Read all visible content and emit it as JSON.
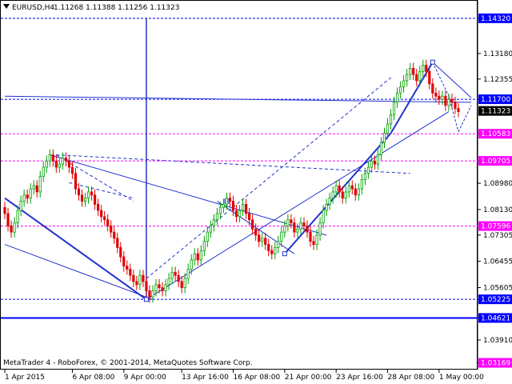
{
  "header": {
    "symbol_timeframe": "EURUSD,H4",
    "ohlc": "1.11268 1.11388 1.11256 1.11323"
  },
  "footer": {
    "copyright": "MetaTrader 4 - RoboForex, © 2001-2014, MetaQuotes Software Corp."
  },
  "colors": {
    "up": "#00a000",
    "down": "#e00000",
    "level_label_blue": "#0000ff",
    "level_label_magenta": "#ff00ff",
    "current_price_bg": "#000000",
    "trend": "#2233cc",
    "magenta_level": "#ff33ff"
  },
  "chart_data": {
    "type": "candlestick",
    "symbol": "EURUSD",
    "timeframe": "H4",
    "ylim": [
      1.0295,
      1.1455
    ],
    "y_ticks": [
      1.1432,
      1.1318,
      1.12355,
      1.117,
      1.10583,
      1.09705,
      1.0898,
      1.0813,
      1.07305,
      1.06455,
      1.05605,
      1.05225,
      1.04621,
      1.0391,
      1.03169
    ],
    "y_tick_labels": [
      "1.14320",
      "1.13180",
      "1.12355",
      "1.11700",
      "1.10583",
      "1.09705",
      "1.08980",
      "1.08130",
      "1.07305",
      "1.06455",
      "1.05605",
      "1.05225",
      "1.04621",
      "1.03910",
      "1.03169"
    ],
    "x_labels": [
      {
        "label": "1 Apr 2015",
        "index": 0
      },
      {
        "label": "6 Apr 08:00",
        "index": 21
      },
      {
        "label": "9 Apr 00:00",
        "index": 37
      },
      {
        "label": "13 Apr 16:00",
        "index": 55
      },
      {
        "label": "16 Apr 08:00",
        "index": 71
      },
      {
        "label": "21 Apr 00:00",
        "index": 87
      },
      {
        "label": "23 Apr 16:00",
        "index": 103
      },
      {
        "label": "28 Apr 08:00",
        "index": 119
      },
      {
        "label": "1 May 00:00",
        "index": 135
      }
    ],
    "levels": [
      {
        "value": 1.1432,
        "label": "1.14320",
        "color": "#0000ff",
        "style": "dashed"
      },
      {
        "value": 1.117,
        "label": "1.11700",
        "color": "#0000ff",
        "style": "dashed"
      },
      {
        "value": 1.11323,
        "label": "1.11323",
        "color": "#000000",
        "style": "none"
      },
      {
        "value": 1.10583,
        "label": "1.10583",
        "color": "#ff00ff",
        "style": "dashed"
      },
      {
        "value": 1.09705,
        "label": "1.09705",
        "color": "#ff00ff",
        "style": "dashed"
      },
      {
        "value": 1.07596,
        "label": "1.07596",
        "color": "#ff00ff",
        "style": "dashed"
      },
      {
        "value": 1.05225,
        "label": "1.05225",
        "color": "#0000ff",
        "style": "dashed"
      },
      {
        "value": 1.04621,
        "label": "1.04621",
        "color": "#0000ff",
        "style": "solid"
      },
      {
        "value": 1.03169,
        "label": "1.03169",
        "color": "#ff00ff",
        "style": "none"
      }
    ],
    "candles_close": [
      1.08,
      1.076,
      1.074,
      1.077,
      1.081,
      1.084,
      1.086,
      1.085,
      1.088,
      1.089,
      1.087,
      1.092,
      1.095,
      1.097,
      1.099,
      1.097,
      1.095,
      1.096,
      1.098,
      1.097,
      1.095,
      1.093,
      1.088,
      1.086,
      1.084,
      1.085,
      1.087,
      1.086,
      1.083,
      1.081,
      1.079,
      1.078,
      1.076,
      1.074,
      1.072,
      1.069,
      1.066,
      1.063,
      1.062,
      1.06,
      1.058,
      1.057,
      1.06,
      1.058,
      1.055,
      1.053,
      1.055,
      1.057,
      1.056,
      1.055,
      1.057,
      1.059,
      1.061,
      1.06,
      1.058,
      1.056,
      1.059,
      1.062,
      1.065,
      1.067,
      1.065,
      1.068,
      1.071,
      1.074,
      1.076,
      1.078,
      1.08,
      1.082,
      1.083,
      1.085,
      1.084,
      1.081,
      1.079,
      1.081,
      1.083,
      1.08,
      1.078,
      1.075,
      1.073,
      1.071,
      1.072,
      1.07,
      1.068,
      1.067,
      1.069,
      1.071,
      1.074,
      1.076,
      1.078,
      1.077,
      1.074,
      1.075,
      1.077,
      1.076,
      1.074,
      1.071,
      1.07,
      1.073,
      1.077,
      1.081,
      1.083,
      1.085,
      1.087,
      1.089,
      1.087,
      1.085,
      1.087,
      1.089,
      1.088,
      1.086,
      1.088,
      1.091,
      1.093,
      1.095,
      1.097,
      1.096,
      1.099,
      1.103,
      1.106,
      1.109,
      1.112,
      1.116,
      1.119,
      1.121,
      1.123,
      1.125,
      1.127,
      1.125,
      1.123,
      1.126,
      1.128,
      1.126,
      1.122,
      1.119,
      1.118,
      1.117,
      1.118,
      1.115,
      1.117,
      1.116,
      1.114,
      1.113
    ],
    "annotations": [
      "double-headed vertical arrow from 1.0522 low to 1.1432 target",
      "channel lines, wave lines and dashed forecast path"
    ]
  }
}
